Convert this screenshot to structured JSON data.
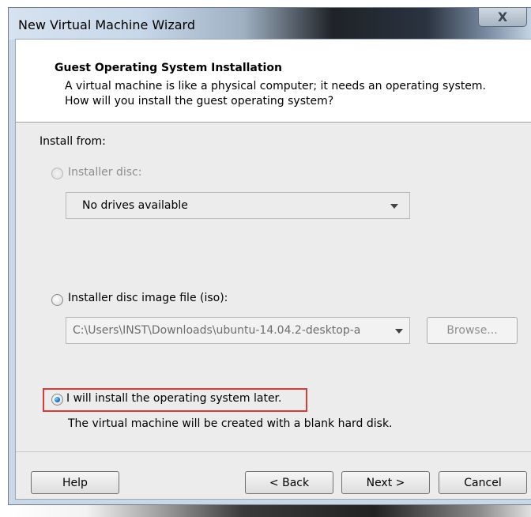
{
  "window": {
    "title": "New Virtual Machine Wizard",
    "close_label": "X"
  },
  "header": {
    "title": "Guest Operating System Installation",
    "description": "A virtual machine is like a physical computer; it needs an operating system. How will you install the guest operating system?"
  },
  "install": {
    "label": "Install from:",
    "options": [
      {
        "label": "Installer disc:",
        "selected": false,
        "enabled": false
      },
      {
        "label": "Installer disc image file (iso):",
        "selected": false,
        "enabled": true
      },
      {
        "label": "I will install the operating system later.",
        "selected": true,
        "enabled": true
      }
    ],
    "disc_dropdown_value": "No drives available",
    "iso_path_value": "C:\\Users\\INST\\Downloads\\ubuntu-14.04.2-desktop-a",
    "browse_label": "Browse...",
    "later_note": "The virtual machine will be created with a blank hard disk."
  },
  "footer": {
    "help_label": "Help",
    "back_label": "< Back",
    "next_label": "Next >",
    "cancel_label": "Cancel"
  },
  "colors": {
    "highlight": "#d93a3a",
    "radio_selected": "#1b6fc9"
  }
}
